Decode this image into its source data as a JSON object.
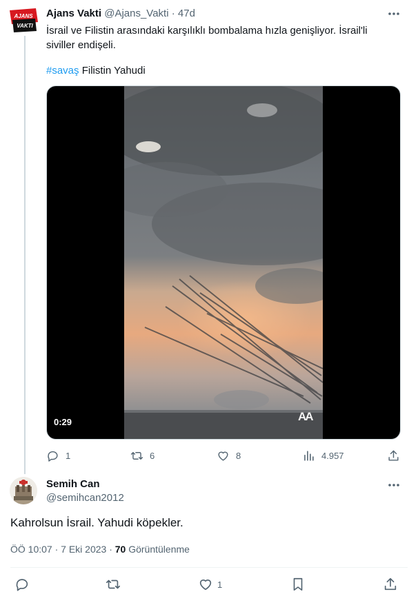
{
  "tweet": {
    "author_name": "Ajans Vakti",
    "handle": "@Ajans_Vakti",
    "separator": "·",
    "time": "47d",
    "avatar_line1": "AJANS",
    "avatar_line2": "VAKTI",
    "text": "İsrail ve Filistin arasındaki karşılıklı  bombalama hızla genişliyor. İsrail'li siviller endişeli.",
    "hashtag": "#savaş",
    "tags_rest": " Filistin Yahudi",
    "video": {
      "duration": "0:29",
      "watermark": "AA"
    },
    "stats": {
      "replies": "1",
      "reposts": "6",
      "likes": "8",
      "views": "4.957"
    }
  },
  "reply": {
    "author_name": "Semih Can",
    "handle": "@semihcan2012",
    "text": "Kahrolsun İsrail. Yahudi köpekler.",
    "time": "ÖÖ 10:07 · 7 Eki 2023 · ",
    "views_count": "70",
    "views_label": " Görüntülenme",
    "stats": {
      "likes": "1"
    }
  },
  "colors": {
    "accent": "#1d9bf0",
    "muted": "#536471",
    "text": "#0f1419",
    "border": "#cfd9de"
  },
  "icons": [
    "more-icon",
    "reply-icon",
    "repost-icon",
    "like-icon",
    "views-icon",
    "share-icon",
    "bookmark-icon"
  ]
}
